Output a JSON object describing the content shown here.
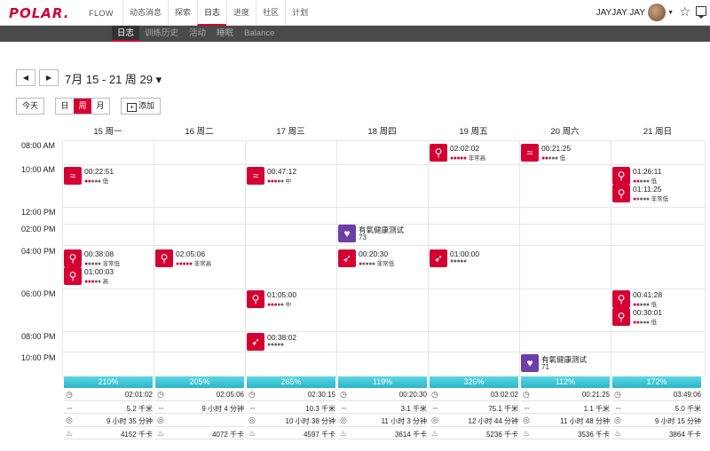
{
  "nav": {
    "logo": "POLAR.",
    "product": "FLOW",
    "items": [
      "动态消息",
      "探索",
      "日志",
      "进度",
      "社区",
      "计划"
    ],
    "active": 2,
    "user": "JAYJAY JAY"
  },
  "subnav": {
    "items": [
      "日志",
      "训练历史",
      "活动",
      "睡眠",
      "Balance"
    ],
    "active": 0
  },
  "controls": {
    "prev": "◀",
    "next": "▶",
    "date_range": "7月 15 - 21 周 29 ▾",
    "today": "今天",
    "views": [
      "日",
      "周",
      "月"
    ],
    "active_view": 1,
    "add": "添加"
  },
  "days": [
    "15 周一",
    "16 周二",
    "17 周三",
    "18 周四",
    "19 周五",
    "20 周六",
    "21 周日"
  ],
  "times": [
    "08:00 AM",
    "10:00 AM",
    "12:00 PM",
    "02:00 PM",
    "04:00 PM",
    "06:00 PM",
    "08:00 PM",
    "10:00 PM"
  ],
  "activities": [
    {
      "day": 0,
      "icon": "swim-icon",
      "glyph": "≈",
      "duration": "00:22:51",
      "load": 2,
      "level": "低"
    },
    {
      "day": 0,
      "icon": "strength-icon",
      "glyph": "⚲",
      "duration": "00:38:08",
      "load": 1,
      "level": "非常低"
    },
    {
      "day": 0,
      "icon": "strength-icon",
      "glyph": "⚲",
      "duration": "01:00:03",
      "load": 3,
      "level": "高"
    },
    {
      "day": 1,
      "icon": "cycling-icon",
      "glyph": "⚲",
      "duration": "02:05:06",
      "load": 5,
      "level": "非常高"
    },
    {
      "day": 2,
      "icon": "swim-icon",
      "glyph": "≈",
      "duration": "00:47:12",
      "load": 3,
      "level": "中"
    },
    {
      "day": 2,
      "icon": "cycling-icon",
      "glyph": "⚲",
      "duration": "01:05:00",
      "load": 3,
      "level": "中"
    },
    {
      "day": 2,
      "icon": "running-icon",
      "glyph": "➶",
      "duration": "00:38:02",
      "load": 0,
      "level": ""
    },
    {
      "day": 3,
      "icon": "fitness-test-icon",
      "glyph": "♥",
      "duration": "有氧健康测试",
      "load": null,
      "level": "73"
    },
    {
      "day": 3,
      "icon": "running-icon",
      "glyph": "➶",
      "duration": "00:20:30",
      "load": 1,
      "level": "非常低"
    },
    {
      "day": 4,
      "icon": "cycling-icon",
      "glyph": "⚲",
      "duration": "02:02:02",
      "load": 5,
      "level": "非常高"
    },
    {
      "day": 4,
      "icon": "running-icon",
      "glyph": "➶",
      "duration": "01:00:00",
      "load": 0,
      "level": ""
    },
    {
      "day": 5,
      "icon": "swim-icon",
      "glyph": "≈",
      "duration": "00:21:25",
      "load": 2,
      "level": "低"
    },
    {
      "day": 5,
      "icon": "fitness-test-icon",
      "glyph": "♥",
      "duration": "有氧健康测试",
      "load": null,
      "level": "71"
    },
    {
      "day": 6,
      "icon": "strength-icon",
      "glyph": "⚲",
      "duration": "01:26:11",
      "load": 2,
      "level": "低"
    },
    {
      "day": 6,
      "icon": "strength-icon",
      "glyph": "⚲",
      "duration": "01:11:25",
      "load": 1,
      "level": "非常低"
    },
    {
      "day": 6,
      "icon": "strength-icon",
      "glyph": "⚲",
      "duration": "00:41:28",
      "load": 2,
      "level": "低"
    },
    {
      "day": 6,
      "icon": "strength-icon",
      "glyph": "⚲",
      "duration": "00:30:01",
      "load": 2,
      "level": "低"
    }
  ],
  "summaries": [
    {
      "percent": "210%",
      "duration": "02:01:02",
      "distance": "5.2 千米",
      "sleep": "9 小时 35 分钟",
      "calories": "4152 千卡"
    },
    {
      "percent": "205%",
      "duration": "02:05:06",
      "distance": "9 小时 4 分钟",
      "sleep": "",
      "calories": "4072 千卡"
    },
    {
      "percent": "265%",
      "duration": "02:30:15",
      "distance": "10.3 千米",
      "sleep": "10 小时 38 分钟",
      "calories": "4597 千卡"
    },
    {
      "percent": "119%",
      "duration": "00:20:30",
      "distance": "3.1 千米",
      "sleep": "11 小时 3 分钟",
      "calories": "3614 千卡"
    },
    {
      "percent": "326%",
      "duration": "03:02:02",
      "distance": "75.1 千米",
      "sleep": "12 小时 44 分钟",
      "calories": "5236 千卡"
    },
    {
      "percent": "112%",
      "duration": "00:21:25",
      "distance": "1.1 千米",
      "sleep": "11 小时 48 分钟",
      "calories": "3536 千卡"
    },
    {
      "percent": "172%",
      "duration": "03:49:06",
      "distance": "5.0 千米",
      "sleep": "9 小时 15 分钟",
      "calories": "3864 千卡"
    }
  ]
}
